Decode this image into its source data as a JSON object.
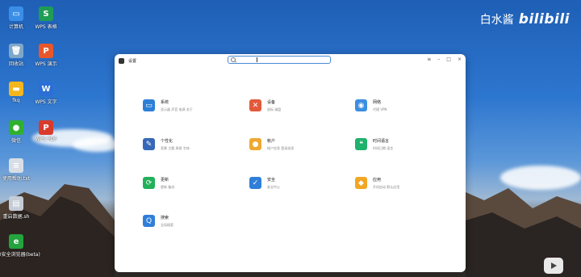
{
  "desktop": {
    "icons": [
      {
        "label": "计算机",
        "glyph": "▭",
        "color": "#3a8ee6"
      },
      {
        "label": "WPS 表格",
        "glyph": "S",
        "color": "#1f9d55"
      },
      {
        "label": "回收站",
        "glyph": "🗑",
        "color": "#7fa7c9"
      },
      {
        "label": "WPS 演示",
        "glyph": "P",
        "color": "#e8572b"
      },
      {
        "label": "fkq",
        "glyph": "▬",
        "color": "#f5b61d"
      },
      {
        "label": "WPS 文字",
        "glyph": "W",
        "color": "#2b6fd6"
      },
      {
        "label": "微信",
        "glyph": "●",
        "color": "#2fb12f"
      },
      {
        "label": "WPS PDF",
        "glyph": "P",
        "color": "#d93b2b"
      },
      {
        "label": "使用帮助.txt",
        "glyph": "≡",
        "color": "#d8dee6"
      },
      {
        "label": "重启数据.sh",
        "glyph": "▤",
        "color": "#c4ccd6"
      },
      {
        "label": "360安全浏览器(beta)",
        "glyph": "e",
        "color": "#23a43d"
      }
    ]
  },
  "watermark": {
    "text": "白水酱",
    "logo": "bilibili"
  },
  "window": {
    "title": "设置",
    "search_placeholder": "",
    "controls": {
      "menu": "≡",
      "min": "–",
      "max": "□",
      "close": "×"
    }
  },
  "settings": [
    {
      "title": "系统",
      "subtitle": "显示器 声音 电源 关于",
      "icon": "monitor-icon",
      "color": "#2d7fd6",
      "glyph": "▭"
    },
    {
      "title": "设备",
      "subtitle": "鼠标 键盘",
      "icon": "tools-icon",
      "color": "#e25a3c",
      "glyph": "✕"
    },
    {
      "title": "网络",
      "subtitle": "代理 VPN",
      "icon": "globe-icon",
      "color": "#3c8fe0",
      "glyph": "◉"
    },
    {
      "title": "个性化",
      "subtitle": "背景 主题 屏保 字体",
      "icon": "brush-icon",
      "color": "#3767b8",
      "glyph": "✎"
    },
    {
      "title": "帐户",
      "subtitle": "帐户信息 登录选项",
      "icon": "user-icon",
      "color": "#f0a830",
      "glyph": "●"
    },
    {
      "title": "时间语言",
      "subtitle": "时间日期 语言",
      "icon": "chat-icon",
      "color": "#1fb26c",
      "glyph": "❝"
    },
    {
      "title": "更新",
      "subtitle": "更新 备份",
      "icon": "refresh-icon",
      "color": "#22b05a",
      "glyph": "⟳"
    },
    {
      "title": "安全",
      "subtitle": "安全中心",
      "icon": "shield-icon",
      "color": "#2f7fd8",
      "glyph": "✓"
    },
    {
      "title": "应用",
      "subtitle": "开机启动 默认应用",
      "icon": "apps-icon",
      "color": "#f2a623",
      "glyph": "◆"
    },
    {
      "title": "搜索",
      "subtitle": "全局搜索",
      "icon": "search-icon",
      "color": "#2f7fd8",
      "glyph": "Q"
    }
  ]
}
